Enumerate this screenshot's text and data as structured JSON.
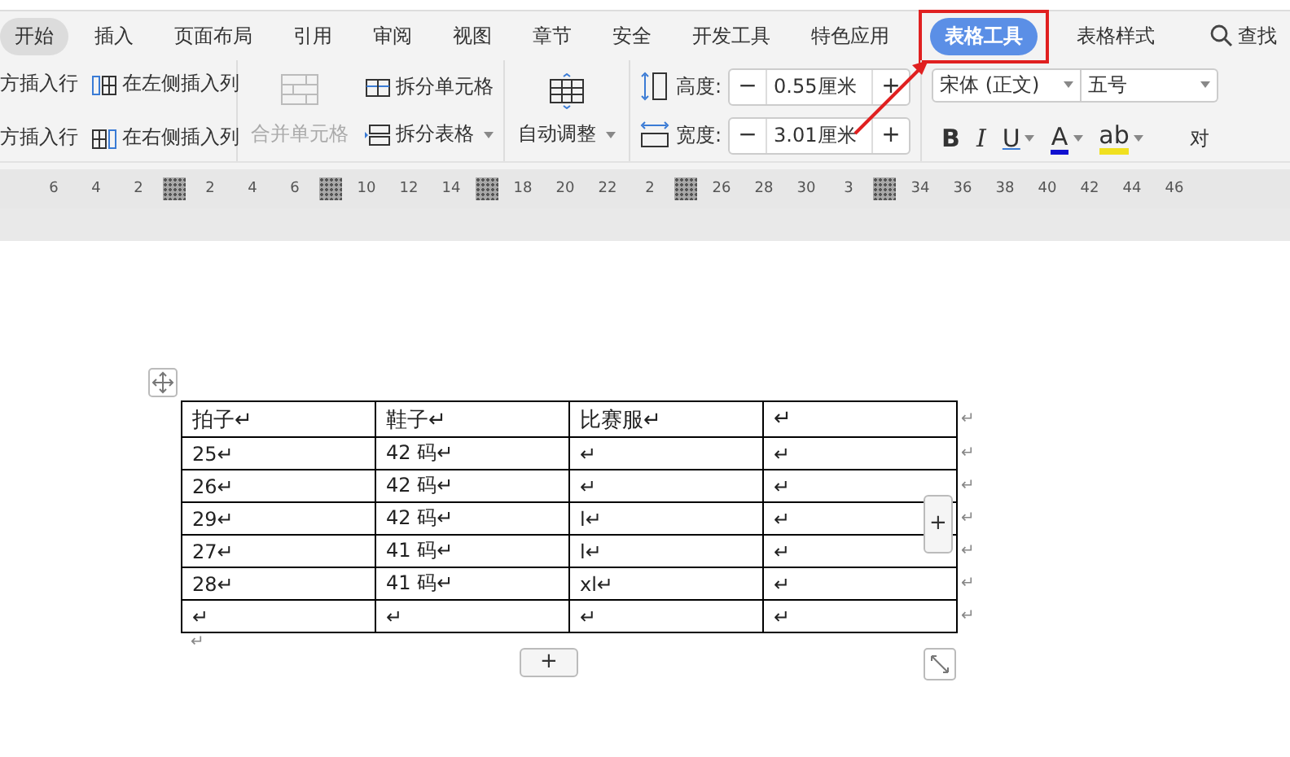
{
  "tabs": [
    {
      "label": "开始",
      "selected": false,
      "hovered": true
    },
    {
      "label": "插入",
      "selected": false,
      "hovered": false
    },
    {
      "label": "页面布局",
      "selected": false,
      "hovered": false
    },
    {
      "label": "引用",
      "selected": false,
      "hovered": false
    },
    {
      "label": "审阅",
      "selected": false,
      "hovered": false
    },
    {
      "label": "视图",
      "selected": false,
      "hovered": false
    },
    {
      "label": "章节",
      "selected": false,
      "hovered": false
    },
    {
      "label": "安全",
      "selected": false,
      "hovered": false
    },
    {
      "label": "开发工具",
      "selected": false,
      "hovered": false
    },
    {
      "label": "特色应用",
      "selected": false,
      "hovered": false
    },
    {
      "label": "表格工具",
      "selected": true,
      "hovered": false
    },
    {
      "label": "表格样式",
      "selected": false,
      "hovered": false
    }
  ],
  "search": {
    "label": "查找"
  },
  "toolbar": {
    "insert_row_above": "方插入行",
    "insert_col_left": "在左侧插入列",
    "insert_row_below": "方插入行",
    "insert_col_right": "在右侧插入列",
    "merge_cells": {
      "label": "合并单元格",
      "disabled": true
    },
    "split_cells": "拆分单元格",
    "split_table": "拆分表格",
    "auto_fit": "自动调整",
    "height": {
      "label": "高度:",
      "value": "0.55厘米",
      "minus": "−",
      "plus": "+"
    },
    "width": {
      "label": "宽度:",
      "value": "3.01厘米",
      "minus": "−",
      "plus": "+"
    },
    "font": "宋体 (正文)",
    "font_size": "五号",
    "format": [
      "B",
      "I",
      "U",
      "A",
      "ab"
    ],
    "align_cut": "对"
  },
  "ruler": [
    {
      "text": "6",
      "kind": "num"
    },
    {
      "text": "4",
      "kind": "num"
    },
    {
      "text": "2",
      "kind": "num"
    },
    {
      "kind": "marker"
    },
    {
      "text": "2",
      "kind": "num"
    },
    {
      "text": "4",
      "kind": "num"
    },
    {
      "text": "6",
      "kind": "num"
    },
    {
      "kind": "marker"
    },
    {
      "text": "10",
      "kind": "num"
    },
    {
      "text": "12",
      "kind": "num"
    },
    {
      "text": "14",
      "kind": "num"
    },
    {
      "kind": "marker"
    },
    {
      "text": "18",
      "kind": "num"
    },
    {
      "text": "20",
      "kind": "num"
    },
    {
      "text": "22",
      "kind": "num"
    },
    {
      "text": "2",
      "kind": "num"
    },
    {
      "kind": "marker"
    },
    {
      "text": "26",
      "kind": "num"
    },
    {
      "text": "28",
      "kind": "num"
    },
    {
      "text": "30",
      "kind": "num"
    },
    {
      "text": "3",
      "kind": "num"
    },
    {
      "kind": "marker"
    },
    {
      "text": "34",
      "kind": "num"
    },
    {
      "text": "36",
      "kind": "num"
    },
    {
      "text": "38",
      "kind": "num"
    },
    {
      "text": "40",
      "kind": "num"
    },
    {
      "text": "42",
      "kind": "num"
    },
    {
      "text": "44",
      "kind": "num"
    },
    {
      "text": "46",
      "kind": "num"
    }
  ],
  "table": {
    "rows": [
      [
        "拍子↵",
        "鞋子↵",
        "比赛服↵",
        "↵"
      ],
      [
        "25↵",
        "42 码↵",
        "↵",
        "↵"
      ],
      [
        "26↵",
        "42 码↵",
        "↵",
        "↵"
      ],
      [
        "29↵",
        "42 码↵",
        "l↵",
        "↵"
      ],
      [
        "27↵",
        "41 码↵",
        "l↵",
        "↵"
      ],
      [
        "28↵",
        "41 码↵",
        "xl↵",
        "↵"
      ],
      [
        "↵",
        "↵",
        "↵",
        "↵"
      ]
    ],
    "row_end_mark": "↵",
    "after_mark": "↵",
    "add_row": "+",
    "add_col": "+"
  }
}
